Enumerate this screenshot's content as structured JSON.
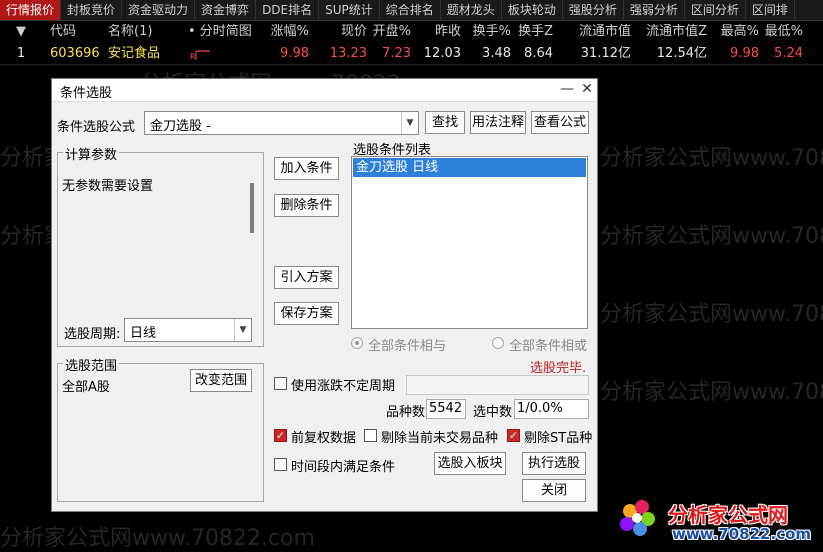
{
  "tabs": [
    "行情报价",
    "封板竞价",
    "资金驱动力",
    "资金博弈",
    "DDE排名",
    "SUP统计",
    "综合排名",
    "题材龙头",
    "板块轮动",
    "强股分析",
    "强弱分析",
    "区间分析",
    "区间排"
  ],
  "columns": [
    "▼",
    "代码",
    "名称(1)",
    "• 分时简图",
    "涨幅%",
    "现价",
    "开盘%",
    "昨收",
    "换手%",
    "换手Z",
    "流通市值",
    "流通市值Z",
    "最高%",
    "最低%"
  ],
  "row": {
    "index": "1",
    "code": "603696",
    "name": "安记食品",
    "spark_flag": "R",
    "change_pct": "9.98",
    "price": "13.23",
    "open_pct": "7.23",
    "prev_close": "12.03",
    "turnover": "3.48",
    "turnover_z": "8.64",
    "float_cap": "31.12亿",
    "float_cap_z": "12.54亿",
    "high_pct": "9.98",
    "low_pct": "5.24"
  },
  "watermark_text": "分析家公式网www.70822.com",
  "dialog": {
    "title": "条件选股",
    "formula_label": "条件选股公式",
    "formula_value": "金刀选股  -",
    "find_btn": "查找",
    "usage_btn": "用法注释",
    "view_btn": "查看公式",
    "params_group": "计算参数",
    "params_text": "无参数需要设置",
    "add_btn": "加入条件",
    "delete_btn": "删除条件",
    "import_btn": "引入方案",
    "save_btn": "保存方案",
    "cond_list_label": "选股条件列表",
    "cond_items": [
      "金刀选股  日线"
    ],
    "period_label": "选股周期:",
    "period_value": "日线",
    "radio_and": "全部条件相与",
    "radio_or": "全部条件相或",
    "status": "选股完毕.",
    "range_group": "选股范围",
    "range_value": "全部A股",
    "change_range_btn": "改变范围",
    "use_period_chk": "使用涨跌不定周期",
    "count_label": "品种数",
    "count_value": "5542",
    "selected_label": "选中数",
    "selected_value": "1/0.0%",
    "adj_chk": "前复权数据",
    "exclude_untraded_chk": "剔除当前未交易品种",
    "exclude_st_chk": "剔除ST品种",
    "time_chk": "时间段内满足条件",
    "to_block_btn": "选股入板块",
    "run_btn": "执行选股",
    "close_btn": "关闭"
  },
  "logo": {
    "cn": "分析家公式网",
    "url": "www.70822.com"
  },
  "colors": {
    "accent_red": "#b01818",
    "up_red": "#ff4a4a",
    "code_yellow": "#ffe24a",
    "selection_blue": "#2f80d8",
    "logo_red": "#e01818",
    "logo_blue": "#1a4fa8"
  }
}
